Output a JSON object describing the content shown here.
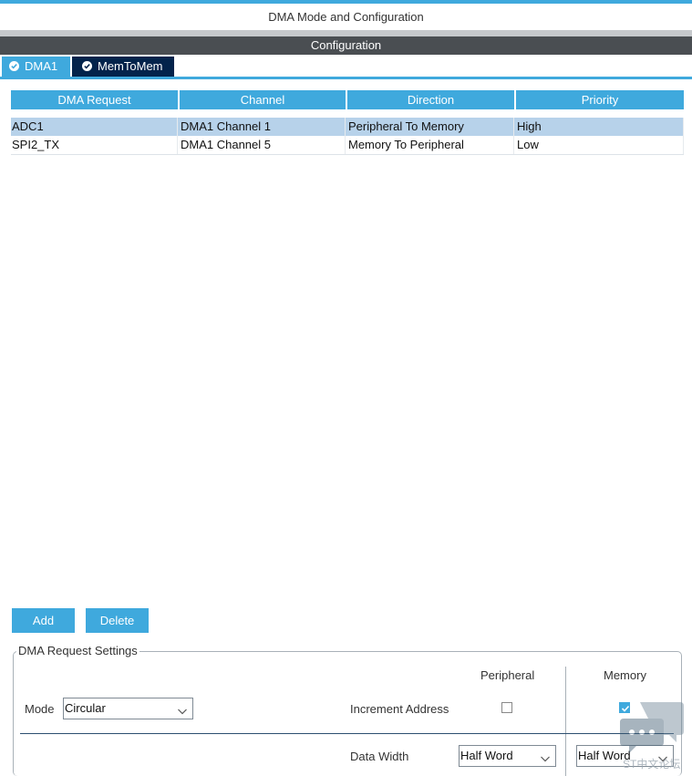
{
  "window": {
    "title": "DMA Mode and Configuration"
  },
  "config_bar": {
    "label": "Configuration"
  },
  "tabs": [
    {
      "label": "DMA1",
      "active": true
    },
    {
      "label": "MemToMem",
      "active": false
    }
  ],
  "table": {
    "headers": [
      "DMA Request",
      "Channel",
      "Direction",
      "Priority"
    ],
    "rows": [
      {
        "request": "ADC1",
        "channel": "DMA1 Channel 1",
        "direction": "Peripheral To Memory",
        "priority": "High",
        "selected": true
      },
      {
        "request": "SPI2_TX",
        "channel": "DMA1 Channel 5",
        "direction": "Memory To Peripheral",
        "priority": "Low",
        "selected": false
      }
    ]
  },
  "buttons": {
    "add": "Add",
    "delete": "Delete"
  },
  "settings": {
    "legend": "DMA Request Settings",
    "peripheral_header": "Peripheral",
    "memory_header": "Memory",
    "mode_label": "Mode",
    "mode_value": "Circular",
    "increment_label": "Increment Address",
    "peripheral_increment": false,
    "memory_increment": true,
    "data_width_label": "Data Width",
    "peripheral_width": "Half Word",
    "memory_width": "Half Word"
  },
  "watermark": {
    "text": "ST中文论坛"
  },
  "colors": {
    "accent": "#3fa9dd",
    "dark_tab": "#03234b",
    "config_bar": "#4a4e52",
    "selected_row": "#b7d2ea"
  },
  "icons": {
    "tab": "check-circle-icon",
    "dropdown": "chevron-down-icon",
    "chat": "chat-bubble-icon"
  }
}
